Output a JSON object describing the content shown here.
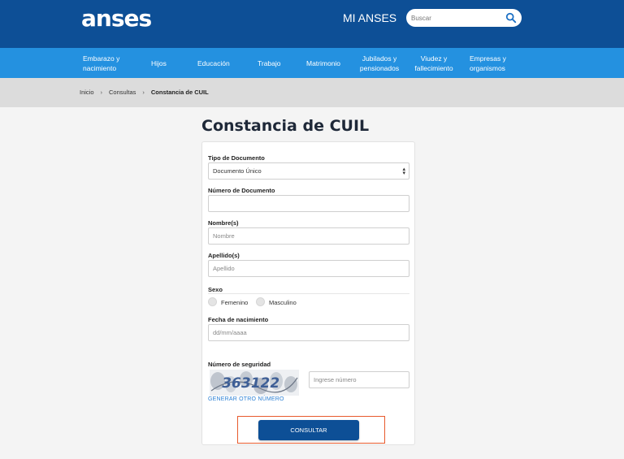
{
  "header": {
    "logo_text": "anses",
    "mi_anses": "MI ANSES",
    "search_placeholder": "Buscar"
  },
  "nav": {
    "items": [
      {
        "line1": "Embarazo y",
        "line2": "nacimiento"
      },
      {
        "line1": "Hijos",
        "line2": ""
      },
      {
        "line1": "Educación",
        "line2": ""
      },
      {
        "line1": "Trabajo",
        "line2": ""
      },
      {
        "line1": "Matrimonio",
        "line2": ""
      },
      {
        "line1": "Jubilados y",
        "line2": "pensionados"
      },
      {
        "line1": "Viudez y",
        "line2": "fallecimiento"
      },
      {
        "line1": "Empresas y",
        "line2": "organismos"
      }
    ]
  },
  "breadcrumb": {
    "home": "Inicio",
    "section": "Consultas",
    "current": "Constancia de CUIL",
    "separator": "›"
  },
  "page": {
    "title": "Constancia de CUIL"
  },
  "form": {
    "doc_type_label": "Tipo de Documento",
    "doc_type_value": "Documento Único",
    "doc_number_label": "Número de Documento",
    "doc_number_placeholder": "",
    "name_label": "Nombre(s)",
    "name_placeholder": "Nombre",
    "surname_label": "Apellido(s)",
    "surname_placeholder": "Apellido",
    "sex_label": "Sexo",
    "sex_female": "Femenino",
    "sex_male": "Masculino",
    "birthdate_label": "Fecha de nacimiento",
    "birthdate_placeholder": "dd/mm/aaaa",
    "security_label": "Número de seguridad",
    "captcha_text": "363122",
    "captcha_placeholder": "Ingrese número",
    "regenerate_label": "GENERAR OTRO NÚMERO",
    "submit_label": "CONSULTAR"
  },
  "colors": {
    "header_bg": "#0d4f96",
    "nav_bg": "#2491e0",
    "breadcrumb_bg": "#dcdcdc",
    "highlight": "#e85a2c",
    "link": "#2a7fd4"
  }
}
